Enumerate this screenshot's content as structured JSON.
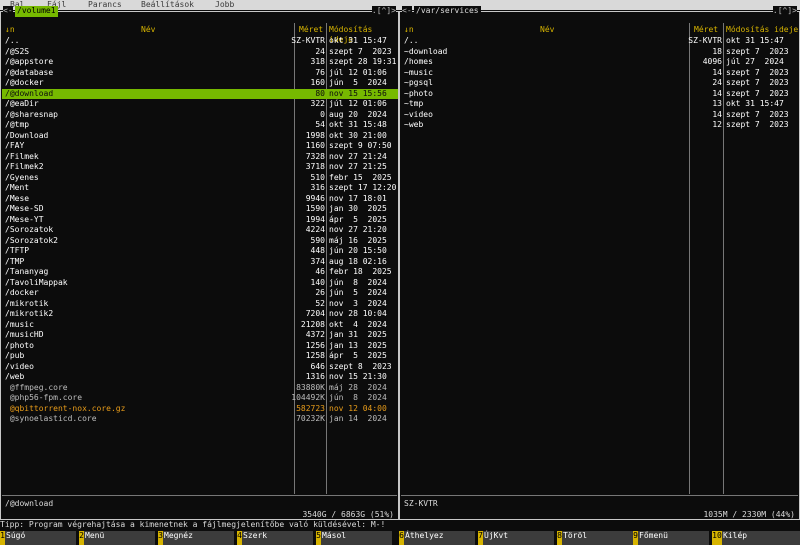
{
  "menubar": [
    "Bal",
    "Fájl",
    "Parancs",
    "Beállítások",
    "Jobb"
  ],
  "left": {
    "title": "/volume1",
    "corner_left": "<-",
    "corner_right": ".[^]>",
    "sort_indicator": "↓n",
    "col_name": "Név",
    "col_size": "Méret",
    "col_mtime": "Módosítás ideje",
    "status_path": "/@download",
    "totals": "3540G / 6863G (51%)",
    "rows": [
      {
        "name": "/..",
        "size": "SZ-KVTR",
        "mtime": "okt 31 15:47"
      },
      {
        "name": "/@S2S",
        "size": "24",
        "mtime": "szept 7  2023"
      },
      {
        "name": "/@appstore",
        "size": "318",
        "mtime": "szept 28 19:31"
      },
      {
        "name": "/@database",
        "size": "76",
        "mtime": "júl 12 01:06"
      },
      {
        "name": "/@docker",
        "size": "160",
        "mtime": "jún  5  2024"
      },
      {
        "name": "/@download",
        "size": "80",
        "mtime": "nov 15 15:56",
        "selected": true
      },
      {
        "name": "/@eaDir",
        "size": "322",
        "mtime": "júl 12 01:06"
      },
      {
        "name": "/@sharesnap",
        "size": "0",
        "mtime": "aug 20  2024"
      },
      {
        "name": "/@tmp",
        "size": "54",
        "mtime": "okt 31 15:48"
      },
      {
        "name": "/Download",
        "size": "1998",
        "mtime": "okt 30 21:00"
      },
      {
        "name": "/FAY",
        "size": "1160",
        "mtime": "szept 9 07:50"
      },
      {
        "name": "/Filmek",
        "size": "7328",
        "mtime": "nov 27 21:24"
      },
      {
        "name": "/Filmek2",
        "size": "3718",
        "mtime": "nov 27 21:25"
      },
      {
        "name": "/Gyenes",
        "size": "510",
        "mtime": "febr 15  2025"
      },
      {
        "name": "/Ment",
        "size": "316",
        "mtime": "szept 17 12:20"
      },
      {
        "name": "/Mese",
        "size": "9946",
        "mtime": "nov 17 18:01"
      },
      {
        "name": "/Mese-SD",
        "size": "1590",
        "mtime": "jan 30  2025"
      },
      {
        "name": "/Mese-YT",
        "size": "1994",
        "mtime": "ápr  5  2025"
      },
      {
        "name": "/Sorozatok",
        "size": "4224",
        "mtime": "nov 27 21:20"
      },
      {
        "name": "/Sorozatok2",
        "size": "590",
        "mtime": "máj 16  2025"
      },
      {
        "name": "/TFTP",
        "size": "448",
        "mtime": "jún 20 15:50"
      },
      {
        "name": "/TMP",
        "size": "374",
        "mtime": "aug 18 02:16"
      },
      {
        "name": "/Tananyag",
        "size": "46",
        "mtime": "febr 18  2025"
      },
      {
        "name": "/TavoliMappak",
        "size": "140",
        "mtime": "jún  8  2024"
      },
      {
        "name": "/docker",
        "size": "26",
        "mtime": "jún  5  2024"
      },
      {
        "name": "/mikrotik",
        "size": "52",
        "mtime": "nov  3  2024"
      },
      {
        "name": "/mikrotik2",
        "size": "7204",
        "mtime": "nov 28 10:04"
      },
      {
        "name": "/music",
        "size": "21208",
        "mtime": "okt  4  2024"
      },
      {
        "name": "/musicHD",
        "size": "4372",
        "mtime": "jan 31  2025"
      },
      {
        "name": "/photo",
        "size": "1256",
        "mtime": "jan 13  2025"
      },
      {
        "name": "/pub",
        "size": "1258",
        "mtime": "ápr  5  2025"
      },
      {
        "name": "/video",
        "size": "646",
        "mtime": "szept 8  2023"
      },
      {
        "name": "/web",
        "size": "1316",
        "mtime": "nov 15 21:30"
      },
      {
        "name": " @ffmpeg.core",
        "size": "83880K",
        "mtime": "máj 28  2024",
        "style": "dim"
      },
      {
        "name": " @php56-fpm.core",
        "size": "104492K",
        "mtime": "jún  8  2024",
        "style": "dim"
      },
      {
        "name": " @qbittorrent-nox.core.gz",
        "size": "582723",
        "mtime": "nov 12 04:00",
        "style": "orange"
      },
      {
        "name": " @synoelasticd.core",
        "size": "70232K",
        "mtime": "jan 14  2024",
        "style": "dim"
      }
    ]
  },
  "right": {
    "title": "/var/services",
    "corner_left": "<-",
    "corner_right": ".[^]>",
    "sort_indicator": "↓n",
    "col_name": "Név",
    "col_size": "Méret",
    "col_mtime": "Módosítás ideje",
    "status_path": "SZ-KVTR",
    "totals": "1035M / 2330M (44%)",
    "rows": [
      {
        "name": "/..",
        "size": "SZ-KVTR",
        "mtime": "okt 31 15:47"
      },
      {
        "name": "~download",
        "size": "18",
        "mtime": "szept 7  2023"
      },
      {
        "name": "/homes",
        "size": "4096",
        "mtime": "júl 27  2024"
      },
      {
        "name": "~music",
        "size": "14",
        "mtime": "szept 7  2023"
      },
      {
        "name": "~pgsql",
        "size": "24",
        "mtime": "szept 7  2023"
      },
      {
        "name": "~photo",
        "size": "14",
        "mtime": "szept 7  2023"
      },
      {
        "name": "~tmp",
        "size": "13",
        "mtime": "okt 31 15:47"
      },
      {
        "name": "~video",
        "size": "14",
        "mtime": "szept 7  2023"
      },
      {
        "name": "~web",
        "size": "12",
        "mtime": "szept 7  2023"
      }
    ]
  },
  "tip": "Tipp: Program végrehajtása a kimenetnek a fájlmegjelenítőbe való küldésével: M-!",
  "fkeys": [
    {
      "num": "1",
      "label": "Súgó"
    },
    {
      "num": "2",
      "label": "Menü"
    },
    {
      "num": "3",
      "label": "Megnéz"
    },
    {
      "num": "4",
      "label": "Szerk"
    },
    {
      "num": "5",
      "label": "Másol"
    },
    {
      "num": "6",
      "label": "Áthelyez"
    },
    {
      "num": "7",
      "label": "ÚjKvt"
    },
    {
      "num": "8",
      "label": "Töröl"
    },
    {
      "num": "9",
      "label": "Főmenü"
    },
    {
      "num": "10",
      "label": "Kilép"
    }
  ]
}
